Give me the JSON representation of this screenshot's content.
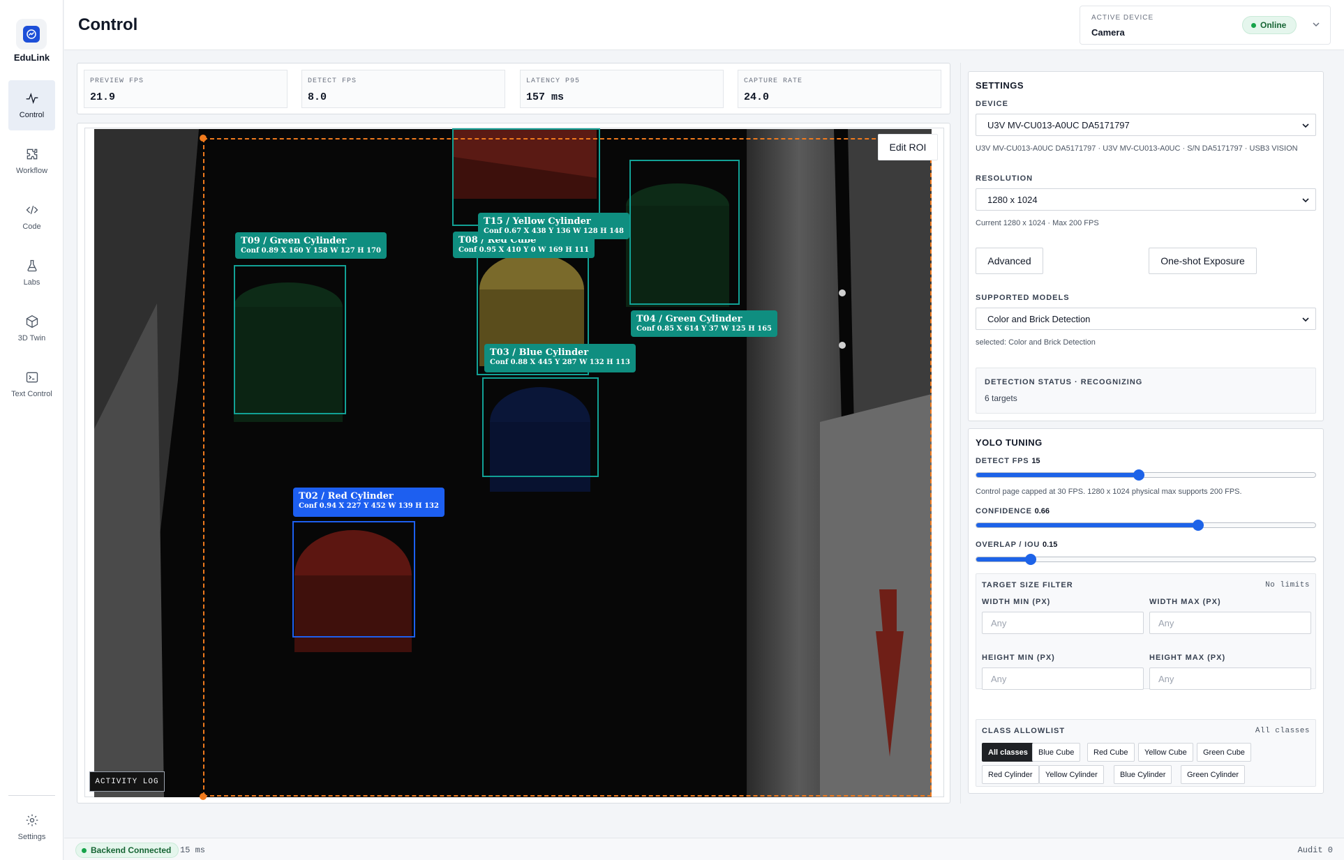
{
  "app": {
    "brand": "EduLink"
  },
  "sidebar": {
    "items": [
      {
        "label": "Control",
        "icon": "activity-icon",
        "active": true
      },
      {
        "label": "Workflow",
        "icon": "puzzle-icon"
      },
      {
        "label": "Code",
        "icon": "code-icon"
      },
      {
        "label": "Labs",
        "icon": "flask-icon"
      },
      {
        "label": "3D Twin",
        "icon": "cube-icon"
      },
      {
        "label": "Text Control",
        "icon": "terminal-icon"
      }
    ],
    "settings_label": "Settings"
  },
  "header": {
    "title": "Control",
    "device_label": "ACTIVE DEVICE",
    "device_value": "Camera",
    "status": "Online"
  },
  "stats": [
    {
      "label": "PREVIEW FPS",
      "value": "21.9"
    },
    {
      "label": "DETECT FPS",
      "value": "8.0"
    },
    {
      "label": "LATENCY P95",
      "value": "157 ms"
    },
    {
      "label": "CAPTURE RATE",
      "value": "24.0"
    }
  ],
  "camera": {
    "edit_roi_label": "Edit ROI",
    "activity_log_label": "ACTIVITY LOG",
    "detections": [
      {
        "name": "T09 / Green Cylinder",
        "meta": "Conf 0.89  X 160  Y 158  W 127  H 170"
      },
      {
        "name": "T15 / Yellow Cylinder",
        "meta": "Conf 0.67  X 438  Y 136  W 128  H 148"
      },
      {
        "name": "T08 / Red Cube",
        "meta": "Conf 0.95  X 410  Y 0  W 169  H 111"
      },
      {
        "name": "T04 / Green Cylinder",
        "meta": "Conf 0.85  X 614  Y 37  W 125  H 165"
      },
      {
        "name": "T03 / Blue Cylinder",
        "meta": "Conf 0.88  X 445  Y 287  W 132  H 113"
      },
      {
        "name": "T02 / Red Cylinder",
        "meta": "Conf 0.94  X 227  Y 452  W 139  H 132"
      }
    ]
  },
  "settings": {
    "title": "SETTINGS",
    "device_label": "DEVICE",
    "device_value": "U3V MV-CU013-A0UC DA5171797",
    "device_helper": "U3V MV-CU013-A0UC DA5171797 · U3V MV-CU013-A0UC · S/N DA5171797 · USB3 VISION",
    "resolution_label": "RESOLUTION",
    "resolution_value": "1280 x 1024",
    "resolution_helper": "Current 1280 x 1024 · Max 200 FPS",
    "advanced_label": "Advanced",
    "oneshot_label": "One-shot Exposure",
    "models_label": "SUPPORTED MODELS",
    "model_value": "Color and Brick Detection",
    "model_helper": "selected: Color and Brick Detection",
    "status_title": "DETECTION STATUS · RECOGNIZING",
    "status_sub": "6 targets"
  },
  "yolo": {
    "title": "YOLO TUNING",
    "detect_fps_label": "DETECT FPS",
    "detect_fps_value": "15",
    "detect_fps_fraction": 0.48,
    "detect_helper": "Control page capped at 30 FPS. 1280 x 1024 physical max supports 200 FPS.",
    "confidence_label": "CONFIDENCE",
    "confidence_value": "0.66",
    "confidence_fraction": 0.655,
    "iou_label": "OVERLAP / IOU",
    "iou_value": "0.15",
    "iou_fraction": 0.16,
    "size_filter_title": "TARGET SIZE FILTER",
    "size_filter_status": "No limits",
    "width_min_label": "WIDTH MIN (PX)",
    "width_max_label": "WIDTH MAX (PX)",
    "height_min_label": "HEIGHT MIN (PX)",
    "height_max_label": "HEIGHT MAX (PX)",
    "input_placeholder": "Any",
    "allowlist_title": "CLASS ALLOWLIST",
    "allowlist_status": "All classes",
    "chips": [
      "All classes",
      "Blue Cube",
      "Red Cube",
      "Yellow Cube",
      "Green Cube",
      "Red Cylinder",
      "Yellow Cylinder",
      "Blue Cylinder",
      "Green Cylinder"
    ]
  },
  "footer": {
    "backend_status": "Backend Connected",
    "latency": "15 ms",
    "audit": "Audit 0"
  },
  "colors": {
    "accent": "#1d63e8",
    "teal_detection": "#0f8e80",
    "blue_detection": "#1d5ff0",
    "roi": "#f07a1d",
    "online": "#16a34a"
  }
}
